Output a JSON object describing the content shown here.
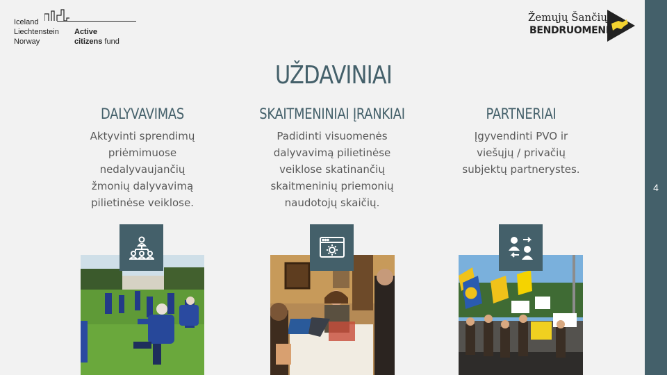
{
  "logos": {
    "funder_lines": [
      "Iceland",
      "Liechtenstein",
      "Norway"
    ],
    "funder_name_bold": "Active",
    "funder_name_bold2": "citizens",
    "funder_name_rest": "fund",
    "partner_line1": "Žemųjų Šančių",
    "partner_line2": "BENDRUOMENĖ"
  },
  "slide": {
    "title": "UŽDAVINIAI",
    "page_number": "4"
  },
  "columns": [
    {
      "heading": "DALYVAVIMAS",
      "lines": [
        "Aktyvinti sprendimų",
        "priėmimuose",
        "nedalyvaujančių",
        "žmonių dalyvavimą",
        "pilietinėse veiklose."
      ],
      "icon": "people-network-icon",
      "photo": "outdoor-exercise-group-photo"
    },
    {
      "heading": "SKAITMENINIAI ĮRANKIAI",
      "lines": [
        "Padidinti visuomenės",
        "dalyvavimą pilietinėse",
        "veiklose skatinančių",
        "skaitmeninių priemonių",
        "naudotojų skaičių."
      ],
      "icon": "browser-settings-icon",
      "photo": "laptop-meeting-photo"
    },
    {
      "heading": "PARTNERIAI",
      "lines": [
        "Įgyvendinti PVO ir",
        "viešųjų / privačių",
        "subjektų partnerystes."
      ],
      "icon": "people-exchange-icon",
      "photo": "street-protest-photo"
    }
  ],
  "colors": {
    "accent": "#44606a",
    "body_text": "#595959",
    "background": "#f2f2f2"
  }
}
